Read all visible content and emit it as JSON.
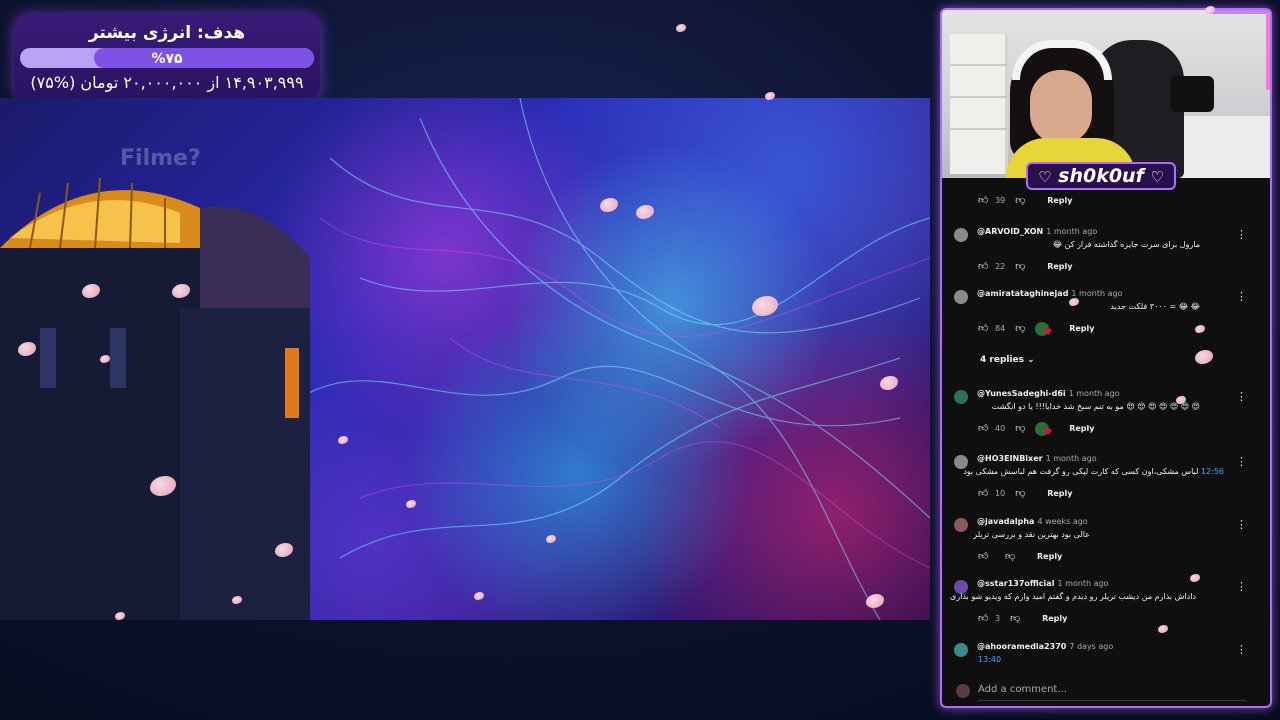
{
  "goal": {
    "title": "هدف: انرژی بیشتر",
    "progress_percent": 75,
    "percent_label": "%۷۵",
    "amount_text": "۱۴,۹۰۳,۹۹۹ از ۲۰,۰۰۰,۰۰۰ تومان (%۷۵)",
    "bar_track_color": "#b9a3f5",
    "bar_fill_color": "#7f52e6"
  },
  "video": {
    "watermark": "Filme?"
  },
  "webcam": {
    "streamer_name": "sh0k0uf",
    "heart": "♡",
    "frame_color": "#b06cff"
  },
  "comments": {
    "reply_label": "Reply",
    "items": [
      {
        "user": "",
        "time": "",
        "text": "",
        "likes": "39",
        "creator_heart": false
      },
      {
        "user": "@ARVOID_XON",
        "time": "1 month ago",
        "text": "مارول برای سرت جایزه گذاشته فرار کن 😂",
        "likes": "22",
        "creator_heart": false
      },
      {
        "user": "@amiratataghinejad",
        "time": "1 month ago",
        "text": "😂 😂 = ۳۰۰۰ فلکت جدید",
        "likes": "84",
        "creator_heart": true,
        "replies_label": "4 replies"
      },
      {
        "user": "@YunesSadeghi-d6i",
        "time": "1 month ago",
        "text": "😍 😍 😍 😍 😍 😍 😍 مو به تنم سیخ شد خدایا!!! یا دو انگشت",
        "likes": "40",
        "creator_heart": true
      },
      {
        "user": "@HO3EINBixer",
        "time": "1 month ago",
        "text": "لباس مشکی،اون کسی که کارت لیکی رو گرفت هم لباسش مشکی بود",
        "timestamp": "12:56",
        "likes": "10",
        "creator_heart": false
      },
      {
        "user": "@javadalpha",
        "time": "4 weeks ago",
        "text": "عالی بود بهترین نقد و بررسی تریلر",
        "likes": "",
        "creator_heart": false
      },
      {
        "user": "@sstar137official",
        "time": "1 month ago",
        "text": "داداش بذارم من دیشب تریلر رو دیدم و گفتم امید وارم که ویدیو شو بذاری",
        "likes": "3",
        "creator_heart": false
      },
      {
        "user": "@ahooramedia2370",
        "time": "7 days ago",
        "text": "",
        "timestamp": "13:40",
        "likes": "",
        "creator_heart": false
      }
    ],
    "add_comment_placeholder": "Add a comment..."
  },
  "icons": {
    "thumb_up": "thumb-up-icon",
    "thumb_down": "thumb-down-icon",
    "kebab": "more-vert-icon",
    "chevron": "chevron-down-icon"
  }
}
